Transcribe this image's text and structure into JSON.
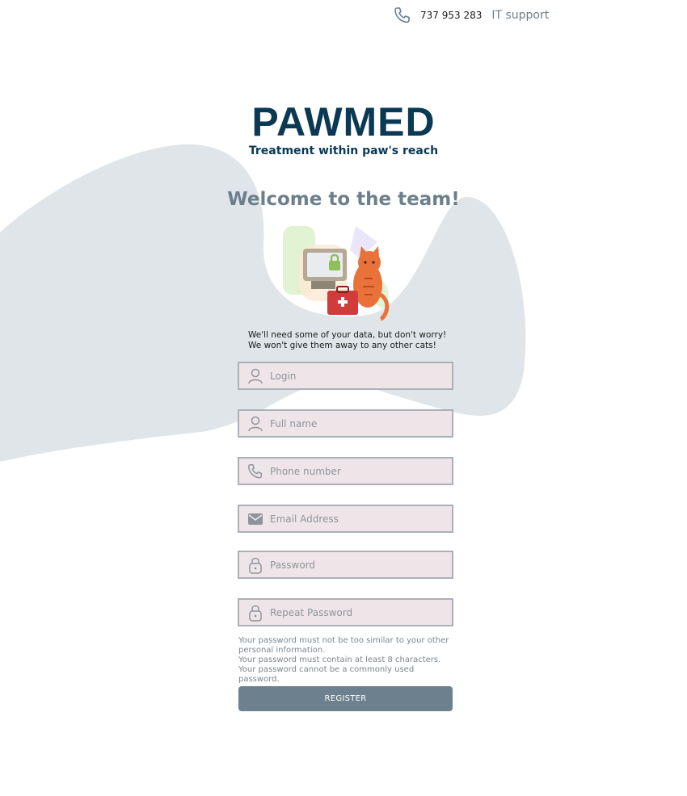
{
  "header": {
    "phone_icon": "phone-icon",
    "phone_number": "737 953 283",
    "it_support": "IT support"
  },
  "brand": {
    "title": "PAWMED",
    "tagline": "Treatment within paw's reach"
  },
  "welcome": "Welcome to the team!",
  "intro": {
    "line1": "We'll need some of your data, but don't worry!",
    "line2": "We won't give them away to any other cats!"
  },
  "form": {
    "login": {
      "icon": "user-icon",
      "placeholder": "Login",
      "value": ""
    },
    "full_name": {
      "icon": "user-icon",
      "placeholder": "Full name",
      "value": ""
    },
    "phone": {
      "icon": "phone-icon",
      "placeholder": "Phone number",
      "value": ""
    },
    "email": {
      "icon": "envelope-icon",
      "placeholder": "Email Address",
      "value": ""
    },
    "password": {
      "icon": "lock-icon",
      "placeholder": "Password",
      "value": ""
    },
    "repeat_password": {
      "icon": "lock-icon",
      "placeholder": "Repeat Password",
      "value": ""
    }
  },
  "password_rules": [
    "Your password must not be too similar to your other personal information.",
    "Your password must contain at least 8 characters.",
    "Your password cannot be a commonly used password."
  ],
  "register_label": "REGISTER",
  "colors": {
    "brand_navy": "#0b3954",
    "muted_slate": "#6b7f8c",
    "field_bg": "#efe5e9",
    "field_border": "#a9b1b7",
    "blob": "#dfe5e8",
    "button": "#6c818d"
  }
}
